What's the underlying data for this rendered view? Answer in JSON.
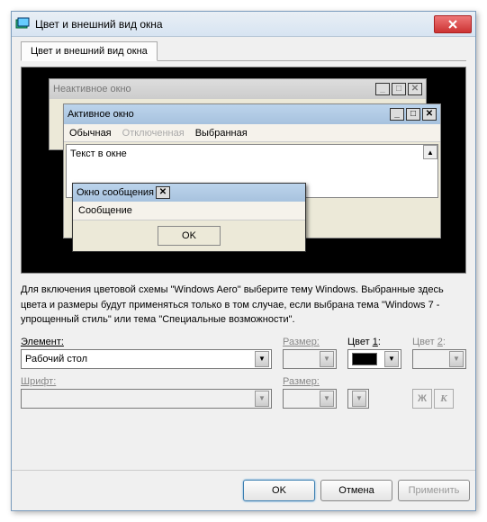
{
  "dialog": {
    "title": "Цвет и внешний вид окна"
  },
  "tab": {
    "label": "Цвет и внешний вид окна"
  },
  "preview": {
    "inactive_title": "Неактивное окно",
    "active_title": "Активное окно",
    "menu_normal": "Обычная",
    "menu_disabled": "Отключенная",
    "menu_selected": "Выбранная",
    "window_text": "Текст в окне",
    "msgbox_title": "Окно сообщения",
    "msgbox_text": "Сообщение",
    "msgbox_ok": "OK"
  },
  "description": "Для включения цветовой схемы \"Windows Aero\" выберите тему Windows. Выбранные здесь цвета и размеры будут применяться только в том случае, если выбрана тема \"Windows 7 - упрощенный стиль\" или тема \"Специальные возможности\".",
  "fields": {
    "element_label": "Элемент:",
    "element_value": "Рабочий стол",
    "size_label": "Размер:",
    "size_value": "",
    "color1_label_pre": "Цвет ",
    "color1_label_u": "1",
    "color1_label_post": ":",
    "color2_label_pre": "Цвет ",
    "color2_label_u": "2",
    "color2_label_post": ":",
    "font_label": "Шрифт:",
    "font_value": "",
    "fontsize_label": "Размер:",
    "fontsize_value": "",
    "color1_hex": "#000000",
    "bold_label": "Ж",
    "italic_label": "К"
  },
  "buttons": {
    "ok": "OK",
    "cancel": "Отмена",
    "apply": "Применить"
  }
}
